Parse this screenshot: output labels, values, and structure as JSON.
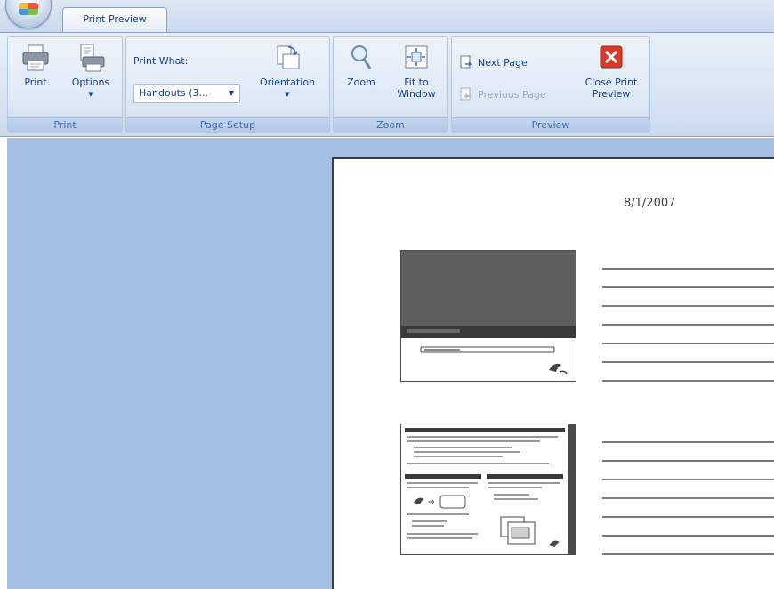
{
  "tabs": [
    {
      "label": "Print Preview",
      "active": true
    }
  ],
  "groups": {
    "print": {
      "label": "Print",
      "buttons": [
        {
          "label": "Print"
        },
        {
          "label": "Options"
        }
      ]
    },
    "page_setup": {
      "label": "Page Setup",
      "print_what_label": "Print What:",
      "print_what_value": "Handouts (3...",
      "orientation_label": "Orientation"
    },
    "zoom": {
      "label": "Zoom",
      "zoom_label": "Zoom",
      "fit_label_line1": "Fit to",
      "fit_label_line2": "Window"
    },
    "preview": {
      "label": "Preview",
      "next_page": "Next Page",
      "previous_page": "Previous Page",
      "close_line1": "Close Print",
      "close_line2": "Preview"
    }
  },
  "page": {
    "date": "8/1/2007",
    "notes_lines_per_slide": 7
  },
  "colors": {
    "workspace_bg": "#a4bfe3",
    "ribbon_text": "#15428b",
    "close_red": "#d8392b"
  }
}
